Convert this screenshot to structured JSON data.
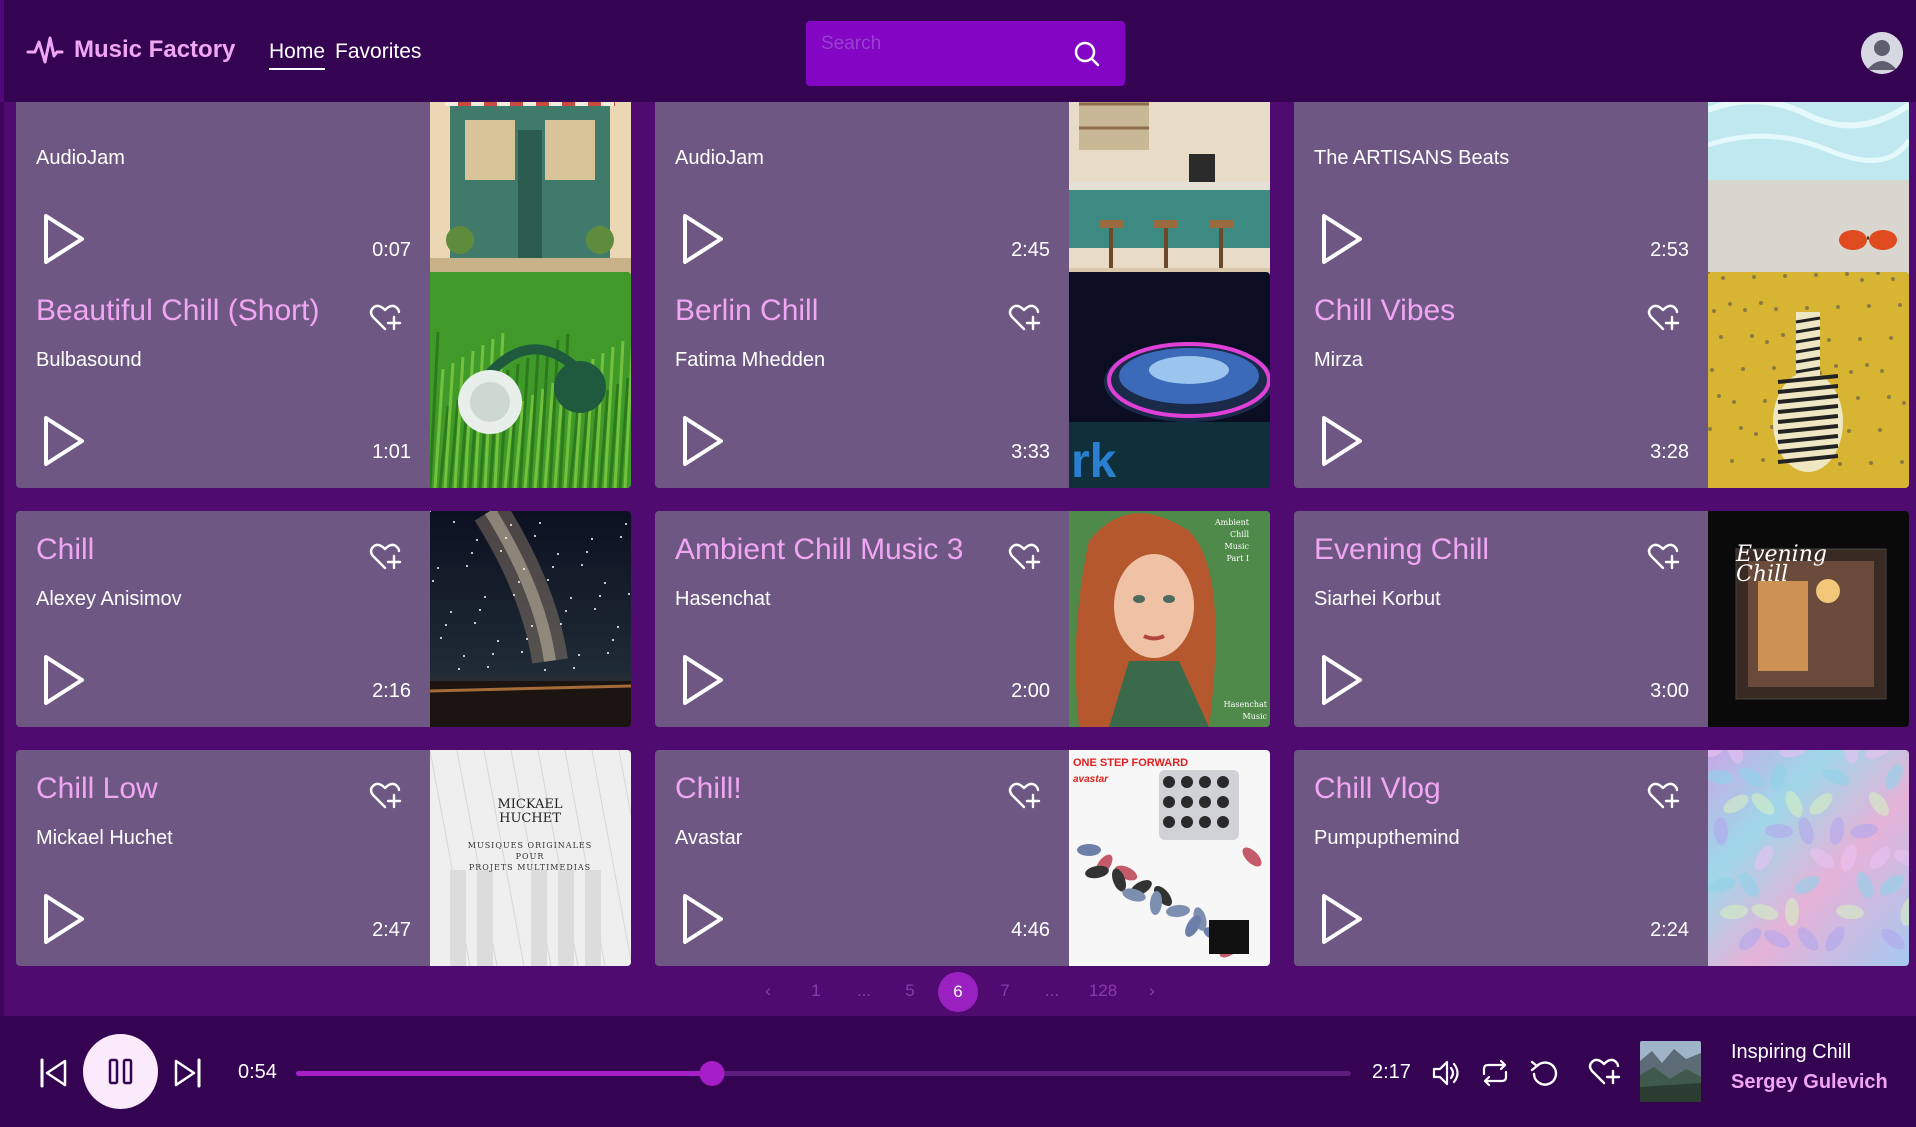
{
  "app": {
    "name": "Music Factory"
  },
  "nav": [
    {
      "label": "Home",
      "active": true
    },
    {
      "label": "Favorites",
      "active": false
    }
  ],
  "search": {
    "placeholder": "Search",
    "value": ""
  },
  "cards": [
    {
      "title": "",
      "artist": "AudioJam",
      "duration": "0:07",
      "art": "cafe-storefront"
    },
    {
      "title": "",
      "artist": "AudioJam",
      "duration": "2:45",
      "art": "coffee-bar"
    },
    {
      "title": "",
      "artist": "The ARTISANS Beats",
      "duration": "2:53",
      "art": "pool-sunglasses"
    },
    {
      "title": "Beautiful Chill (Short)",
      "artist": "Bulbasound",
      "duration": "1:01",
      "art": "headphones-grass"
    },
    {
      "title": "Berlin Chill",
      "artist": "Fatima Mhedden",
      "duration": "3:33",
      "art": "dj-turntable"
    },
    {
      "title": "Chill Vibes",
      "artist": "Mirza",
      "duration": "3:28",
      "art": "zebra-gold"
    },
    {
      "title": "Chill",
      "artist": "Alexey Anisimov",
      "duration": "2:16",
      "art": "milky-way"
    },
    {
      "title": "Ambient Chill Music 3",
      "artist": "Hasenchat",
      "duration": "2:00",
      "art": "portrait-woman",
      "art_text": [
        "Ambient",
        "Chill",
        "Music",
        "Part I",
        "Hasenchat",
        "Music"
      ]
    },
    {
      "title": "Evening Chill",
      "artist": "Siarhei Korbut",
      "duration": "3:00",
      "art": "evening-chill-cover",
      "art_text": [
        "Evening",
        "Chill"
      ]
    },
    {
      "title": "Chill Low",
      "artist": "Mickael Huchet",
      "duration": "2:47",
      "art": "piano-keys",
      "art_text": [
        "MICKAEL",
        "HUCHET",
        "MUSIQUES ORIGINALES",
        "POUR",
        "PROJETS MULTIMEDIAS"
      ]
    },
    {
      "title": "Chill!",
      "artist": "Avastar",
      "duration": "4:46",
      "art": "pills",
      "art_text": [
        "ONE STEP FORWARD",
        "avastar"
      ]
    },
    {
      "title": "Chill Vlog",
      "artist": "Pumpupthemind",
      "duration": "2:24",
      "art": "holographic"
    }
  ],
  "pagination": {
    "prev": "‹",
    "next": "›",
    "pages": [
      "1",
      "...",
      "5",
      "6",
      "7",
      "...",
      "128"
    ],
    "current": "6"
  },
  "player": {
    "elapsed": "0:54",
    "total": "2:17",
    "progress": 0.394,
    "state": "playing",
    "now_playing": {
      "title": "Inspiring Chill",
      "artist": "Sergey Gulevich"
    }
  },
  "colors": {
    "header_bg": "#340452",
    "accent": "#f0a6f3",
    "card_bg": "#6e5883",
    "search_bg": "#8206c4",
    "progress": "#a61ec8"
  }
}
